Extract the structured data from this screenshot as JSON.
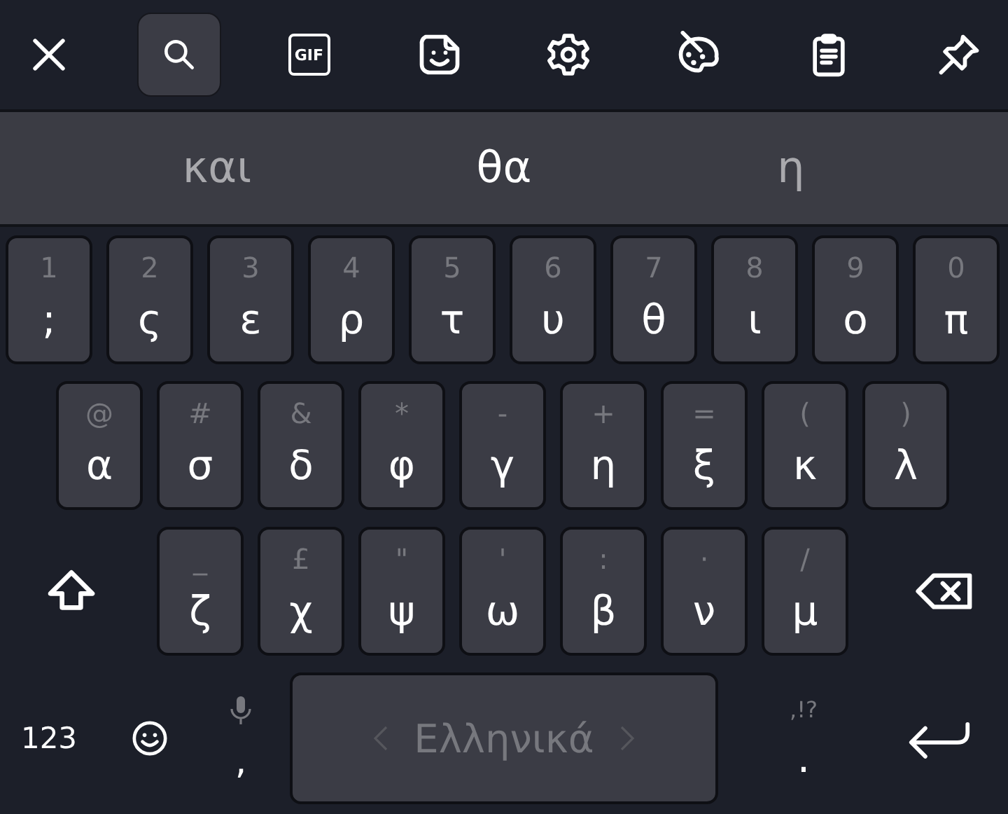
{
  "toolbar": {
    "items": [
      {
        "kind": "close",
        "selected": false
      },
      {
        "kind": "search",
        "selected": true
      },
      {
        "kind": "gif",
        "label": "GIF",
        "selected": false
      },
      {
        "kind": "sticker",
        "selected": false
      },
      {
        "kind": "settings",
        "selected": false
      },
      {
        "kind": "theme",
        "selected": false
      },
      {
        "kind": "clipboard",
        "selected": false
      },
      {
        "kind": "pin",
        "selected": false
      }
    ]
  },
  "suggestions": [
    {
      "text": "και",
      "primary": false
    },
    {
      "text": "θα",
      "primary": true
    },
    {
      "text": "η",
      "primary": false
    }
  ],
  "keyboard": {
    "rows": [
      [
        {
          "kind": "letter",
          "hint": "1",
          "label": ";"
        },
        {
          "kind": "letter",
          "hint": "2",
          "label": "ς"
        },
        {
          "kind": "letter",
          "hint": "3",
          "label": "ε"
        },
        {
          "kind": "letter",
          "hint": "4",
          "label": "ρ"
        },
        {
          "kind": "letter",
          "hint": "5",
          "label": "τ"
        },
        {
          "kind": "letter",
          "hint": "6",
          "label": "υ"
        },
        {
          "kind": "letter",
          "hint": "7",
          "label": "θ"
        },
        {
          "kind": "letter",
          "hint": "8",
          "label": "ι"
        },
        {
          "kind": "letter",
          "hint": "9",
          "label": "ο"
        },
        {
          "kind": "letter",
          "hint": "0",
          "label": "π"
        }
      ],
      [
        {
          "kind": "letter",
          "hint": "@",
          "label": "α"
        },
        {
          "kind": "letter",
          "hint": "#",
          "label": "σ"
        },
        {
          "kind": "letter",
          "hint": "&",
          "label": "δ"
        },
        {
          "kind": "letter",
          "hint": "*",
          "label": "φ"
        },
        {
          "kind": "letter",
          "hint": "-",
          "label": "γ"
        },
        {
          "kind": "letter",
          "hint": "+",
          "label": "η"
        },
        {
          "kind": "letter",
          "hint": "=",
          "label": "ξ"
        },
        {
          "kind": "letter",
          "hint": "(",
          "label": "κ"
        },
        {
          "kind": "letter",
          "hint": ")",
          "label": "λ"
        }
      ],
      [
        {
          "kind": "shift"
        },
        {
          "kind": "letter",
          "hint": "_",
          "label": "ζ"
        },
        {
          "kind": "letter",
          "hint": "£",
          "label": "χ"
        },
        {
          "kind": "letter",
          "hint": "\"",
          "label": "ψ"
        },
        {
          "kind": "letter",
          "hint": "'",
          "label": "ω"
        },
        {
          "kind": "letter",
          "hint": ":",
          "label": "β"
        },
        {
          "kind": "letter",
          "hint": "·",
          "label": "ν"
        },
        {
          "kind": "letter",
          "hint": "/",
          "label": "μ"
        },
        {
          "kind": "backspace"
        }
      ]
    ]
  },
  "bottom_bar": {
    "keys": [
      {
        "kind": "symbols",
        "label": "123"
      },
      {
        "kind": "emoji"
      },
      {
        "kind": "comma",
        "label": ","
      },
      {
        "kind": "space",
        "label": "Ελληνικά"
      },
      {
        "kind": "period",
        "hint": ",!?",
        "label": "."
      },
      {
        "kind": "enter"
      }
    ]
  }
}
